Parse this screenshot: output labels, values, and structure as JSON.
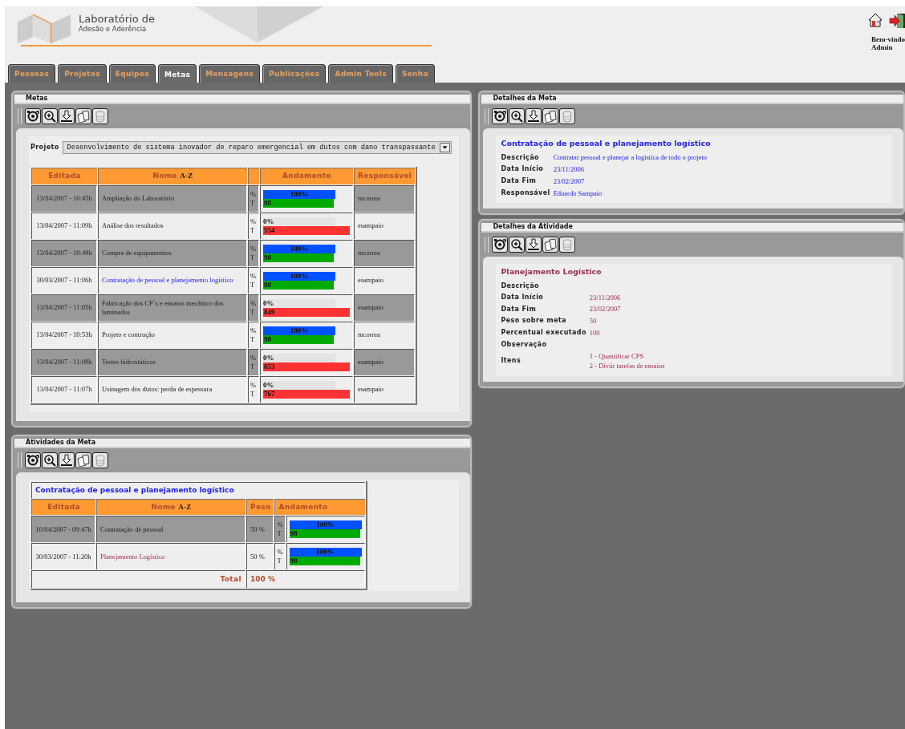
{
  "header": {
    "logo_title": "Laboratório de",
    "logo_subtitle": "Adesão e Aderência",
    "welcome": "Bem-vindo",
    "user": "Admin"
  },
  "tabs": [
    {
      "label": "Pessoas",
      "selected": false
    },
    {
      "label": "Projetos",
      "selected": false
    },
    {
      "label": "Equipes",
      "selected": false
    },
    {
      "label": "Metas",
      "selected": true
    },
    {
      "label": "Mensagens",
      "selected": false
    },
    {
      "label": "Publicações",
      "selected": false
    },
    {
      "label": "Admin Tools",
      "selected": false
    },
    {
      "label": "Senha",
      "selected": false
    }
  ],
  "toolbar_buttons": [
    {
      "kind": "refresh",
      "disabled": false
    },
    {
      "kind": "zoom",
      "disabled": false
    },
    {
      "kind": "download",
      "disabled": false
    },
    {
      "kind": "documents",
      "disabled": false
    },
    {
      "kind": "trash",
      "disabled": true
    }
  ],
  "metas": {
    "title": "Metas",
    "project_label": "Projeto",
    "project_value": "Desenvolvimento de sistema inovador de reparo emergencial em dutos com dano transpassante",
    "columns": [
      {
        "label": "Editada"
      },
      {
        "label": "Nome",
        "sort": "A-Z"
      },
      {
        "kind": "blank"
      },
      {
        "label": "Andamento"
      },
      {
        "label": "Responsável"
      }
    ],
    "rows": [
      {
        "edited": "13/04/2007 - 10:45h",
        "name": "Ampliação do Laboratório",
        "selected": false,
        "progress": {
          "percent_label": "%",
          "time_label": "T",
          "percent": "100%",
          "level": 1,
          "time": "98",
          "color": "#00aa00"
        },
        "responsible": "mcorrea"
      },
      {
        "edited": "13/04/2007 - 11:09h",
        "name": "Análise dos resultados",
        "selected": false,
        "progress": {
          "percent_label": "%",
          "time_label": "T",
          "percent": "0%",
          "level": 0,
          "time": "554",
          "color": "#ff3333"
        },
        "responsible": "esampaio"
      },
      {
        "edited": "13/04/2007 - 10:48h",
        "name": "Compra de equipamentos",
        "selected": false,
        "progress": {
          "percent_label": "%",
          "time_label": "T",
          "percent": "100%",
          "level": 1,
          "time": "98",
          "color": "#00aa00"
        },
        "responsible": "mcorrea"
      },
      {
        "edited": "30/03/2007 - 11:06h",
        "name": "Contratação de pessoal e planejamento logístico",
        "selected": true,
        "progress": {
          "percent_label": "%",
          "time_label": "T",
          "percent": "100%",
          "level": 1,
          "time": "98",
          "color": "#00aa00"
        },
        "responsible": "esampaio"
      },
      {
        "edited": "13/04/2007 - 11:05h",
        "name": "Fabricação dos CP´s e ensaios mecânico dos laminados",
        "selected": false,
        "progress": {
          "percent_label": "%",
          "time_label": "T",
          "percent": "0%",
          "level": 0,
          "time": "849",
          "color": "#ff3333"
        },
        "responsible": "esampaio"
      },
      {
        "edited": "13/04/2007 - 10:53h",
        "name": "Projeto e contrução",
        "selected": false,
        "progress": {
          "percent_label": "%",
          "time_label": "T",
          "percent": "100%",
          "level": 1,
          "time": "98",
          "color": "#00aa00"
        },
        "responsible": "mcorrea"
      },
      {
        "edited": "13/04/2007 - 11:08h",
        "name": "Testes hidrostáticos",
        "selected": false,
        "progress": {
          "percent_label": "%",
          "time_label": "T",
          "percent": "0%",
          "level": 0,
          "time": "653",
          "color": "#ff3333"
        },
        "responsible": "esampaio"
      },
      {
        "edited": "13/04/2007 - 11:07h",
        "name": "Usinagem dos dutos: perda de espessura",
        "selected": false,
        "progress": {
          "percent_label": "%",
          "time_label": "T",
          "percent": "0%",
          "level": 0,
          "time": "767",
          "color": "#ff3333"
        },
        "responsible": "esampaio"
      }
    ]
  },
  "atividades": {
    "title": "Atividades da Meta",
    "heading": "Contratação de pessoal e planejamento logístico",
    "columns": [
      {
        "label": "Editada"
      },
      {
        "label": "Nome",
        "sort": "A-Z"
      },
      {
        "label": "Peso"
      },
      {
        "label": "Andamento",
        "kind": "progress"
      }
    ],
    "rows": [
      {
        "edited": "10/04/2007 - 09:47h",
        "name": "Contratação de pessoal",
        "selected": false,
        "weight": "50 %",
        "progress": {
          "percent_label": "%",
          "time_label": "T",
          "percent": "100%",
          "level": 1,
          "time": "98",
          "color": "#00aa00"
        }
      },
      {
        "edited": "30/03/2007 - 11:20h",
        "name": "Planejamento Logístico",
        "selected": true,
        "weight": "50 %",
        "progress": {
          "percent_label": "%",
          "time_label": "T",
          "percent": "100%",
          "level": 1,
          "time": "98",
          "color": "#00aa00"
        }
      }
    ],
    "total_label": "Total",
    "total_value": "100 %"
  },
  "detalhes_meta": {
    "title": "Detalhes da Meta",
    "heading": "Contratação de pessoal e planejamento logístico",
    "fields": [
      {
        "label": "Descrição",
        "values": [
          "Contratar pessoal e planejar a logistica de todo o projeto"
        ]
      },
      {
        "label": "Data Início",
        "values": [
          "23/11/2006"
        ]
      },
      {
        "label": "Data Fim",
        "values": [
          "23/02/2007"
        ]
      },
      {
        "label": "Responsável",
        "values": [
          "Eduardo Sampaio"
        ]
      }
    ]
  },
  "detalhes_atividade": {
    "title": "Detalhes da Atividade",
    "heading": "Planejamento Logístico",
    "fields": [
      {
        "label": "Descrição"
      },
      {
        "label": "Data Início",
        "values": [
          "23/11/2006"
        ]
      },
      {
        "label": "Data Fim",
        "values": [
          "23/02/2007"
        ]
      },
      {
        "label": "Peso sobre meta",
        "values": [
          "50"
        ]
      },
      {
        "label": "Percentual executado",
        "values": [
          "100"
        ]
      },
      {
        "label": "Observação"
      },
      {
        "label": "Itens",
        "values": [
          "1 - Quantificar CPS",
          "2 - Diviir tarefas de ensaios"
        ]
      }
    ]
  }
}
